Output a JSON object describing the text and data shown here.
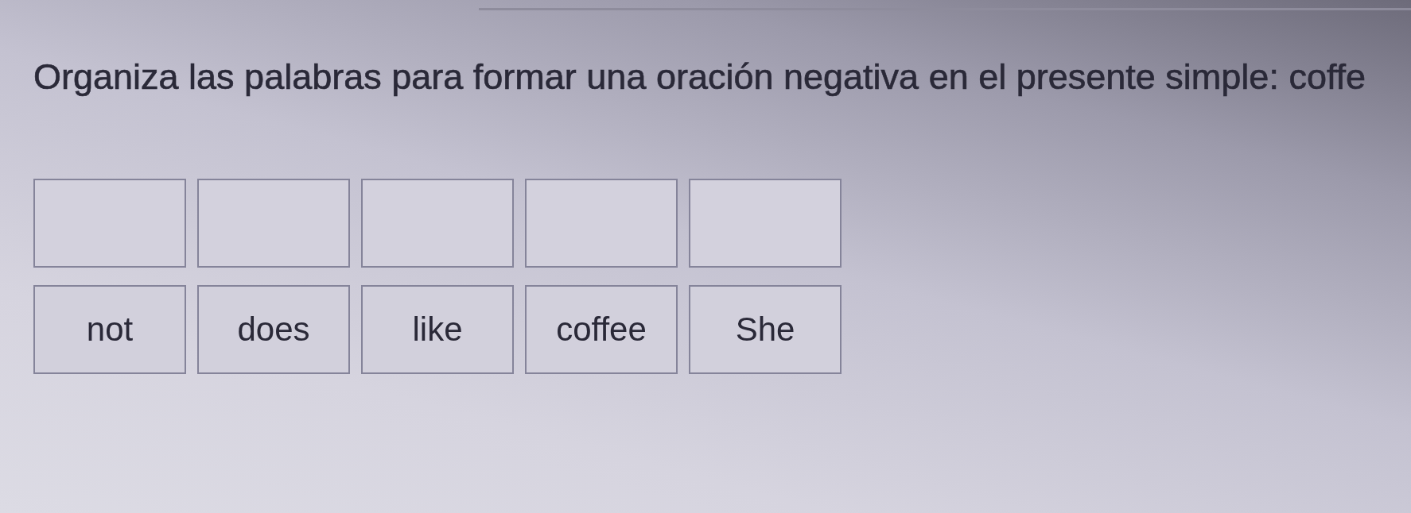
{
  "instruction": "Organiza las palabras para formar una oración negativa en el presente simple: coffe",
  "answer_slots": [
    {
      "kind": "drop-zone"
    },
    {
      "kind": "drop-zone"
    },
    {
      "kind": "drop-zone"
    },
    {
      "kind": "drop-zone"
    },
    {
      "kind": "drop-zone"
    }
  ],
  "word_tiles": [
    "not",
    "does",
    "like",
    "coffee",
    "She"
  ]
}
